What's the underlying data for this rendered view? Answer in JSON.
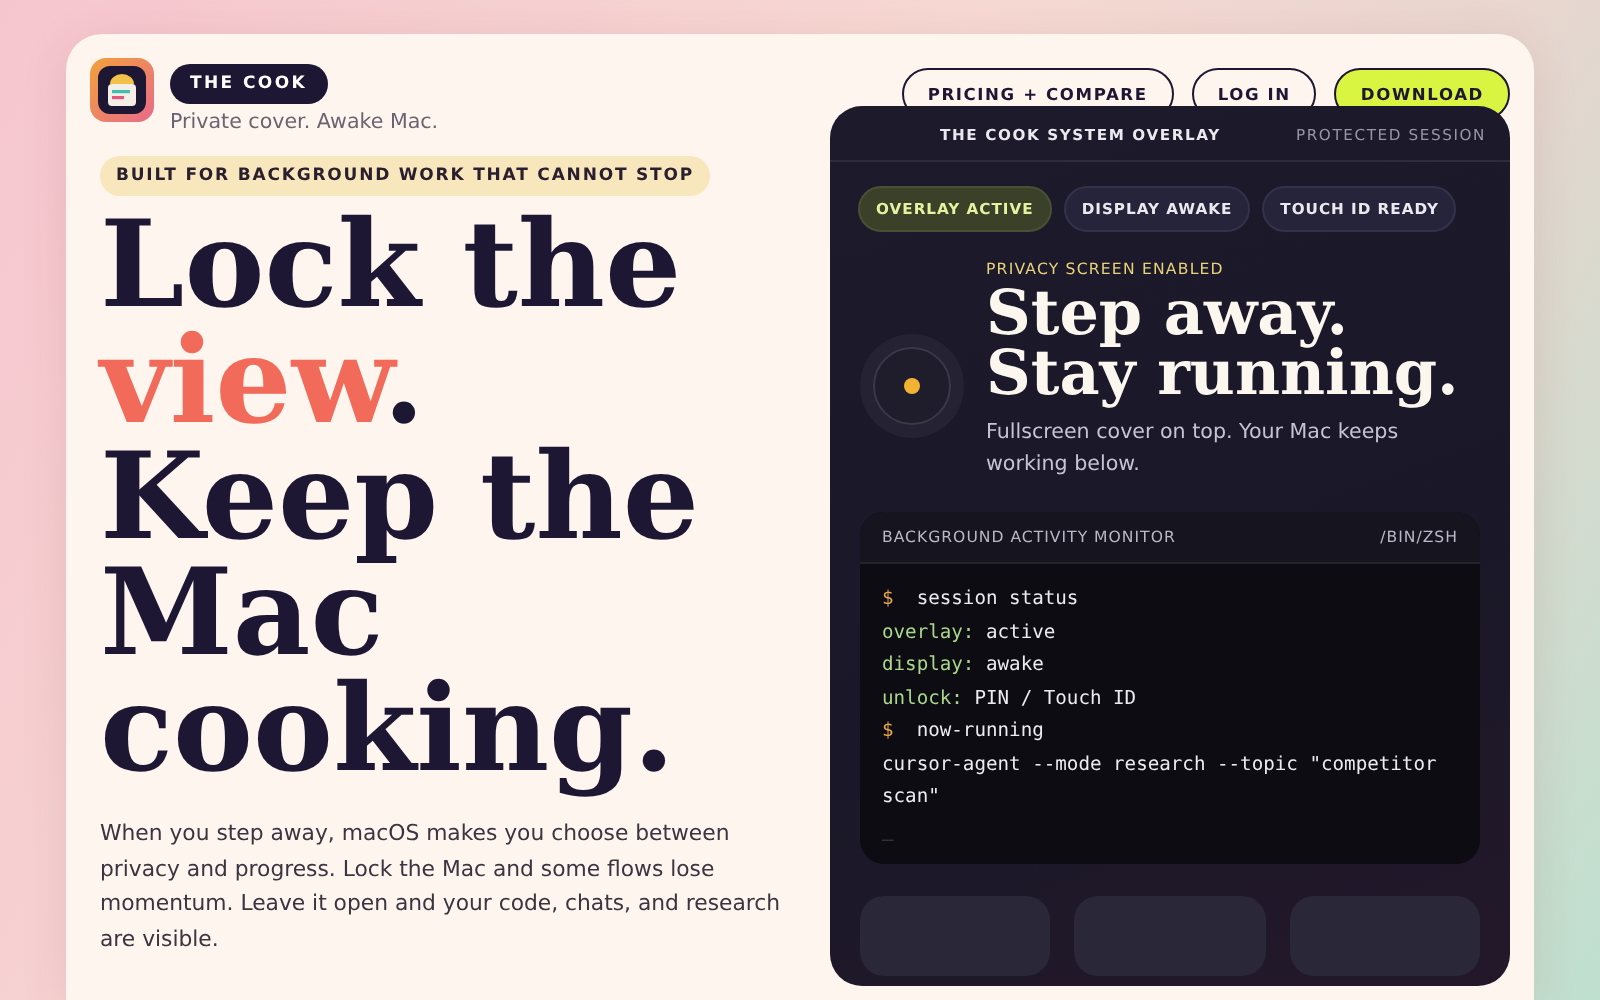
{
  "brand": {
    "name": "THE COOK",
    "tagline": "Private cover. Awake Mac."
  },
  "nav": [
    {
      "label": "PRICING + COMPARE",
      "kind": "outline"
    },
    {
      "label": "LOG IN",
      "kind": "outline"
    },
    {
      "label": "DOWNLOAD",
      "kind": "primary"
    }
  ],
  "hero": {
    "eyebrow": "BUILT FOR BACKGROUND WORK THAT CANNOT STOP",
    "headline": [
      {
        "text": "Lock the ",
        "accent": false
      },
      {
        "text": "view",
        "accent": true
      },
      {
        "text": ". Keep the Mac cooking.",
        "accent": false
      }
    ],
    "body": "When you step away, macOS makes you choose between privacy and progress. Lock the Mac and some flows lose momentum. Leave it open and your code, chats, and research are visible."
  },
  "overlay_panel": {
    "title": "THE COOK SYSTEM OVERLAY",
    "session": "PROTECTED SESSION",
    "status_pills": [
      {
        "label": "OVERLAY ACTIVE",
        "selected": true
      },
      {
        "label": "DISPLAY AWAKE",
        "selected": false
      },
      {
        "label": "TOUCH ID READY",
        "selected": false
      }
    ],
    "eyebrow": "PRIVACY SCREEN ENABLED",
    "title_lines": [
      "Step away.",
      "Stay running."
    ],
    "description": "Fullscreen cover on top. Your Mac keeps working below.",
    "terminal": {
      "title": "BACKGROUND ACTIVITY MONITOR",
      "shell": "/BIN/ZSH",
      "lines": [
        {
          "kind": "command",
          "prompt": "$",
          "text": "session status"
        },
        {
          "kind": "field",
          "key": "overlay:",
          "value": "active"
        },
        {
          "kind": "field",
          "key": "display:",
          "value": "awake"
        },
        {
          "kind": "field",
          "key": "unlock:",
          "value": "PIN / Touch ID"
        },
        {
          "kind": "command",
          "prompt": "$",
          "text": "now-running"
        },
        {
          "kind": "plain",
          "text": "cursor-agent --mode research --topic \"competitor scan\""
        },
        {
          "kind": "cursor",
          "text": "_"
        }
      ]
    }
  }
}
